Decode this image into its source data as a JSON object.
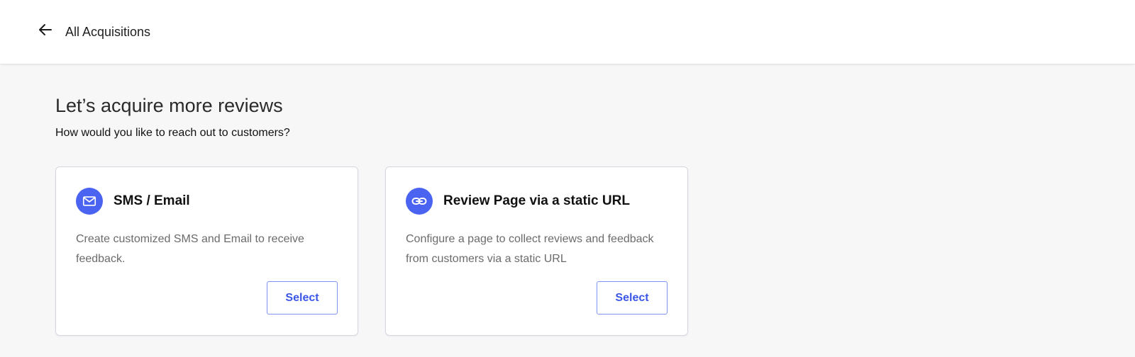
{
  "header": {
    "back_icon": "arrow-left-icon",
    "back_label": "All Acquisitions"
  },
  "main": {
    "title": "Let’s acquire more reviews",
    "subtitle": "How would you like to reach out to customers?",
    "accent_color": "#4a63f0",
    "options": [
      {
        "icon": "mail-icon",
        "title": "SMS / Email",
        "description": "Create customized SMS and Email to receive feedback.",
        "button_label": "Select"
      },
      {
        "icon": "link-icon",
        "title": "Review Page via a static URL",
        "description": "Configure a page to collect reviews and feedback from customers via a static URL",
        "button_label": "Select"
      }
    ]
  }
}
